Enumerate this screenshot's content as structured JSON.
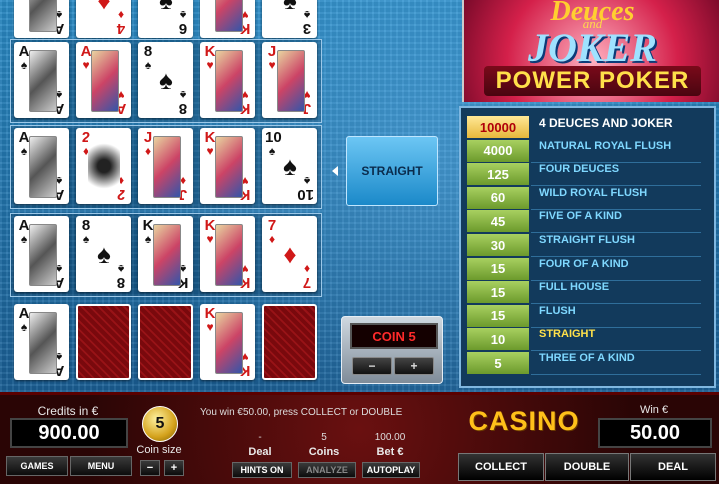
{
  "logo": {
    "line1": "Deuces",
    "line2": "and",
    "line3": "JOKER",
    "line4": "POWER POKER"
  },
  "hands": [
    {
      "cards": [
        {
          "rank": "A",
          "suit": "♠",
          "color": "blk",
          "type": "face-bw"
        },
        {
          "rank": "4",
          "suit": "♦",
          "color": "red",
          "type": "num"
        },
        {
          "rank": "6",
          "suit": "♠",
          "color": "blk",
          "type": "num"
        },
        {
          "rank": "K",
          "suit": "♥",
          "color": "red",
          "type": "face"
        },
        {
          "rank": "3",
          "suit": "♠",
          "color": "blk",
          "type": "num"
        }
      ]
    },
    {
      "cards": [
        {
          "rank": "A",
          "suit": "♠",
          "color": "blk",
          "type": "face-bw"
        },
        {
          "rank": "A",
          "suit": "♥",
          "color": "red",
          "type": "face"
        },
        {
          "rank": "8",
          "suit": "♠",
          "color": "blk",
          "type": "num"
        },
        {
          "rank": "K",
          "suit": "♥",
          "color": "red",
          "type": "face"
        },
        {
          "rank": "J",
          "suit": "♥",
          "color": "red",
          "type": "face"
        }
      ]
    },
    {
      "cards": [
        {
          "rank": "A",
          "suit": "♠",
          "color": "blk",
          "type": "face-bw"
        },
        {
          "rank": "2",
          "suit": "♦",
          "color": "red",
          "type": "joker"
        },
        {
          "rank": "J",
          "suit": "♦",
          "color": "red",
          "type": "face"
        },
        {
          "rank": "K",
          "suit": "♥",
          "color": "red",
          "type": "face"
        },
        {
          "rank": "10",
          "suit": "♠",
          "color": "blk",
          "type": "num"
        }
      ]
    },
    {
      "cards": [
        {
          "rank": "A",
          "suit": "♠",
          "color": "blk",
          "type": "face-bw"
        },
        {
          "rank": "8",
          "suit": "♠",
          "color": "blk",
          "type": "num"
        },
        {
          "rank": "K",
          "suit": "♠",
          "color": "blk",
          "type": "face"
        },
        {
          "rank": "K",
          "suit": "♥",
          "color": "red",
          "type": "face"
        },
        {
          "rank": "7",
          "suit": "♦",
          "color": "red",
          "type": "num"
        }
      ]
    },
    {
      "cards": [
        {
          "rank": "A",
          "suit": "♠",
          "color": "blk",
          "type": "face-bw"
        },
        {
          "type": "back"
        },
        {
          "type": "back"
        },
        {
          "rank": "K",
          "suit": "♥",
          "color": "red",
          "type": "face"
        },
        {
          "type": "back"
        }
      ]
    }
  ],
  "result_label": "STRAIGHT",
  "coin_display": "COIN 5",
  "coin_minus": "−",
  "coin_plus": "+",
  "paytable": [
    {
      "value": "10000",
      "name": "4 DEUCES AND JOKER"
    },
    {
      "value": "4000",
      "name": "NATURAL ROYAL FLUSH"
    },
    {
      "value": "125",
      "name": "FOUR DEUCES"
    },
    {
      "value": "60",
      "name": "WILD ROYAL FLUSH"
    },
    {
      "value": "45",
      "name": "FIVE OF A KIND"
    },
    {
      "value": "30",
      "name": "STRAIGHT FLUSH"
    },
    {
      "value": "15",
      "name": "FOUR OF A KIND"
    },
    {
      "value": "15",
      "name": "FULL HOUSE"
    },
    {
      "value": "15",
      "name": "FLUSH"
    },
    {
      "value": "10",
      "name": "STRAIGHT"
    },
    {
      "value": "5",
      "name": "THREE OF A KIND"
    }
  ],
  "bottom": {
    "credits_label": "Credits in €",
    "credits_value": "900.00",
    "games_label": "GAMES",
    "menu_label": "MENU",
    "coin_size_value": "5",
    "coin_size_label": "Coin size",
    "coin_size_minus": "−",
    "coin_size_plus": "+",
    "message": "You win €50.00, press COLLECT or DOUBLE",
    "deal_value": "-",
    "deal_label": "Deal",
    "coins_value": "5",
    "coins_label": "Coins",
    "bet_value": "100.00",
    "bet_label": "Bet €",
    "hints_label": "HINTS ON",
    "analyze_label": "ANALYZE",
    "autoplay_label": "AUTOPLAY",
    "casino_label": "CASINO",
    "win_label": "Win €",
    "win_value": "50.00",
    "collect_label": "COLLECT",
    "double_label": "DOUBLE",
    "deal_btn_label": "DEAL"
  },
  "colors": {
    "accent": "#ffc01a",
    "paytable_value": "#8cb848",
    "highlight": "#ffe14a"
  }
}
